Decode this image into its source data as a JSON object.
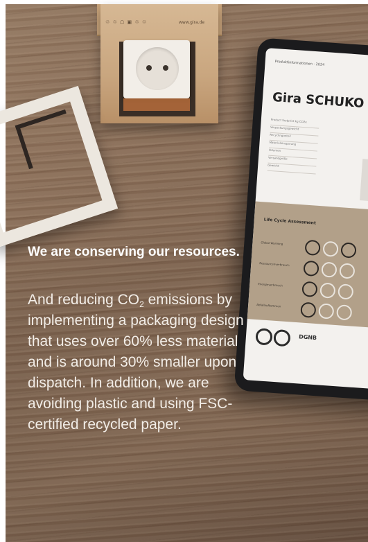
{
  "headline": "We are conserving our resources.",
  "body_prefix": "And reducing CO",
  "body_subscript": "2",
  "body_text": " emissions by implementing a packaging design that uses over 60% less material and is around 30% smaller upon dispatch. In addition, we are avoiding plastic and using FSC-certified recycled paper.",
  "photo": {
    "box_print": "♲ ♲ ☖ ▣ ♲ ♲",
    "box_url": "www.gira.de",
    "tablet": {
      "doc_header": "Produktinformationen · 2024",
      "doc_title": "Gira SCHUKO",
      "spec_lines": [
        "Product footprint kg CO2e",
        "Verpackungsgewicht",
        "Recyclinganteil",
        "Materialeinsparung",
        "Volumen",
        "Versandgröße",
        "Gewicht"
      ],
      "lca_title": "Life Cycle Assessment",
      "lca_rows": [
        "Global Warming",
        "Ressourcenverbrauch",
        "Energieverbrauch",
        "Abfallaufkommen"
      ],
      "badge_text": "DGNB"
    }
  }
}
